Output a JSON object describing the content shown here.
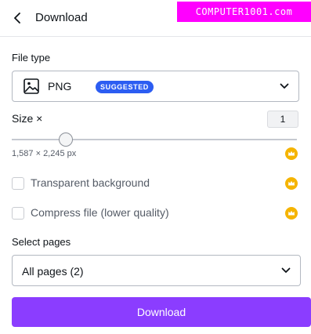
{
  "header": {
    "title": "Download",
    "back_icon": "chevron-left-icon"
  },
  "watermark": {
    "text": "COMPUTER1001.com",
    "color": "#ff00ff"
  },
  "file_type": {
    "label": "File type",
    "value": "PNG",
    "badge": "SUGGESTED",
    "icon": "image-icon"
  },
  "size": {
    "label": "Size ×",
    "multiplier": "1",
    "dimensions": "1,587 × 2,245 px",
    "slider_level": 0.19
  },
  "options": [
    {
      "label": "Transparent background",
      "checked": false,
      "premium": true
    },
    {
      "label": "Compress file (lower quality)",
      "checked": false,
      "premium": true
    }
  ],
  "select_pages": {
    "label": "Select pages",
    "value": "All pages (2)"
  },
  "download_button": {
    "label": "Download"
  },
  "colors": {
    "accent": "#8b3dff",
    "badge": "#2c5df2",
    "crown": "#f5b400"
  }
}
